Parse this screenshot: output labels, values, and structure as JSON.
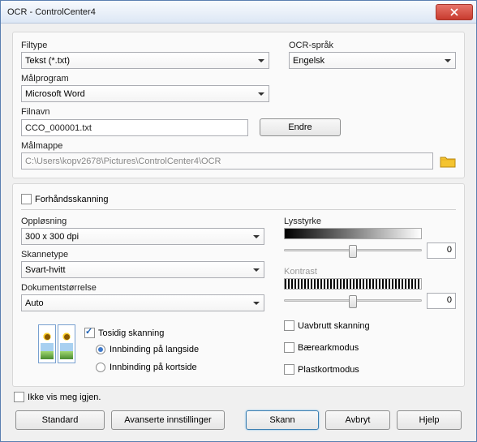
{
  "window": {
    "title": "OCR - ControlCenter4"
  },
  "filetype": {
    "label": "Filtype",
    "value": "Tekst (*.txt)"
  },
  "ocrlang": {
    "label": "OCR-språk",
    "value": "Engelsk"
  },
  "targetprog": {
    "label": "Målprogram",
    "value": "Microsoft Word"
  },
  "filename": {
    "label": "Filnavn",
    "value": "CCO_000001.txt",
    "change_btn": "Endre"
  },
  "targetfolder": {
    "label": "Målmappe",
    "value": "C:\\Users\\kopv2678\\Pictures\\ControlCenter4\\OCR"
  },
  "prescan": {
    "label": "Forhåndsskanning"
  },
  "resolution": {
    "label": "Oppløsning",
    "value": "300 x 300 dpi"
  },
  "scantype": {
    "label": "Skannetype",
    "value": "Svart-hvitt"
  },
  "docsize": {
    "label": "Dokumentstørrelse",
    "value": "Auto"
  },
  "duplex": {
    "label": "Tosidig skanning",
    "long_side": "Innbinding på langside",
    "short_side": "Innbinding på kortside"
  },
  "brightness": {
    "label": "Lysstyrke",
    "value": "0"
  },
  "contrast": {
    "label": "Kontrast",
    "value": "0"
  },
  "continuous": {
    "label": "Uavbrutt skanning"
  },
  "carrier": {
    "label": "Bærearkmodus"
  },
  "plastic": {
    "label": "Plastkortmodus"
  },
  "dontshow": {
    "label": "Ikke vis meg igjen."
  },
  "buttons": {
    "default": "Standard",
    "advanced": "Avanserte innstillinger",
    "scan": "Skann",
    "cancel": "Avbryt",
    "help": "Hjelp"
  }
}
